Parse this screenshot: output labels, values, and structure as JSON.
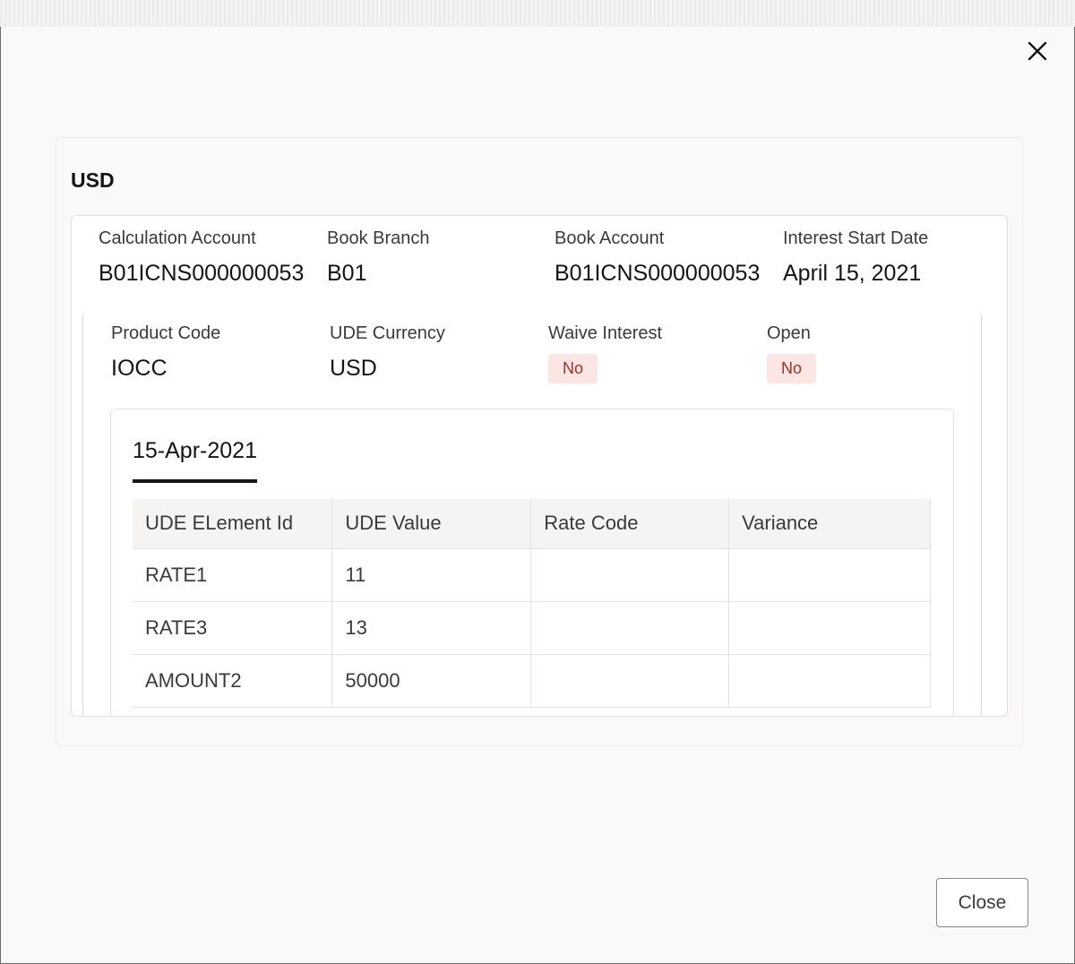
{
  "section": {
    "title": "USD"
  },
  "account": {
    "calc_account_label": "Calculation Account",
    "calc_account_value": "B01ICNS000000053",
    "book_branch_label": "Book Branch",
    "book_branch_value": "B01",
    "book_account_label": "Book Account",
    "book_account_value": "B01ICNS000000053",
    "interest_start_label": "Interest Start Date",
    "interest_start_value": "April 15, 2021"
  },
  "product": {
    "product_code_label": "Product Code",
    "product_code_value": "IOCC",
    "ude_currency_label": "UDE Currency",
    "ude_currency_value": "USD",
    "waive_interest_label": "Waive Interest",
    "waive_interest_value": "No",
    "open_label": "Open",
    "open_value": "No"
  },
  "tab": {
    "label": "15-Apr-2021"
  },
  "table": {
    "headers": [
      "UDE ELement Id",
      "UDE Value",
      "Rate Code",
      "Variance"
    ],
    "rows": [
      [
        "RATE1",
        "11",
        "",
        ""
      ],
      [
        "RATE3",
        "13",
        "",
        ""
      ],
      [
        "AMOUNT2",
        "50000",
        "",
        ""
      ]
    ]
  },
  "footer": {
    "close_label": "Close"
  },
  "icons": {
    "close": "close-icon"
  },
  "colors": {
    "badge_bg": "#fbe6e3",
    "badge_text": "#9b3325"
  }
}
